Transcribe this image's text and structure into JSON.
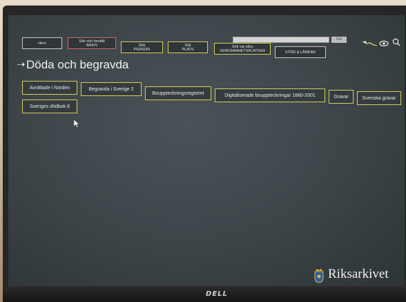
{
  "nav": {
    "home": "Hem",
    "archive": [
      "Sök och beställ",
      "ARKIV"
    ],
    "person": [
      "Sök",
      "PERSON"
    ],
    "place": [
      "Sök",
      "PLATS"
    ],
    "workplaces": [
      "Sök via våra",
      "VERKSAMHETSPLATSER"
    ],
    "support": "STÖD & LÄNKAR"
  },
  "search": {
    "placeholder": "",
    "button": "Sök"
  },
  "page": {
    "title": "Döda och begravda"
  },
  "categories": [
    "Avrättade i Norden",
    "Begravda i Sverige 2",
    "Bouppteckningsregistret",
    "Digitaliserade bouppteckningar 1880-2001",
    "Gravar",
    "Svenska gravar",
    "Sveriges dödbok 8"
  ],
  "logo": {
    "text": "Riksarkivet"
  },
  "monitor": {
    "brand": "DELL"
  },
  "colors": {
    "background": "#3c4448",
    "text": "#e8e8e8",
    "button_border_yellow": "#d8cf55",
    "button_border_red": "#d06a6a",
    "button_border_grey": "#c9c9c9"
  }
}
